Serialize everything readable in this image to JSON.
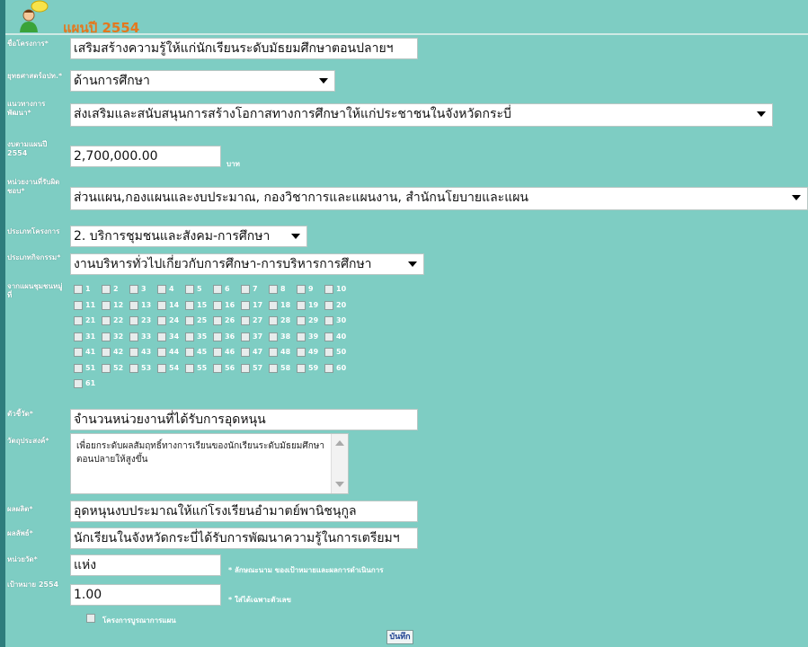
{
  "header": {
    "title": "แผนปี 2554"
  },
  "form": {
    "project_name": {
      "label": "ชื่อโครงการ*",
      "value": "เสริมสร้างความรู้ให้แก่นักเรียนระดับมัธยมศึกษาตอนปลายฯ"
    },
    "strategy": {
      "label": "ยุทธศาสตร์อปท.*",
      "value": "ด้านการศึกษา"
    },
    "development_guideline": {
      "label": "แนวทางการพัฒนา*",
      "value": "ส่งเสริมและสนับสนุนการสร้างโอกาสทางการศึกษาให้แก่ประชาชนในจังหวัดกระบี่"
    },
    "budget": {
      "label": "งบตามแผนปี 2554",
      "value": "2,700,000.00",
      "unit": "บาท"
    },
    "responsible_unit": {
      "label": "หน่วยงานที่รับผิดชอบ*",
      "value": "ส่วนแผน,กองแผนและงบประมาณ, กองวิชาการและแผนงาน, สำนักนโยบายและแผน"
    },
    "project_type": {
      "label": "ประเภทโครงการ",
      "value": "2. บริการชุมชนและสังคม-การศึกษา"
    },
    "activity_type": {
      "label": "ประเภทกิจกรรม*",
      "value": "งานบริหารทั่วไปเกี่ยวกับการศึกษา-การบริหารการศึกษา"
    },
    "village_plan": {
      "label": "จากแผนชุมชนหมู่ที่",
      "rows": [
        [
          "1",
          "2",
          "3",
          "4",
          "5",
          "6",
          "7",
          "8",
          "9",
          "10"
        ],
        [
          "11",
          "12",
          "13",
          "14",
          "15",
          "16",
          "17",
          "18",
          "19",
          "20"
        ],
        [
          "21",
          "22",
          "23",
          "24",
          "25",
          "26",
          "27",
          "28",
          "29",
          "30"
        ],
        [
          "31",
          "32",
          "33",
          "34",
          "35",
          "36",
          "37",
          "38",
          "39",
          "40"
        ],
        [
          "41",
          "42",
          "43",
          "44",
          "45",
          "46",
          "47",
          "48",
          "49",
          "50"
        ],
        [
          "51",
          "52",
          "53",
          "54",
          "55",
          "56",
          "57",
          "58",
          "59",
          "60"
        ],
        [
          "61"
        ]
      ]
    },
    "indicator": {
      "label": "ตัวชี้วัด*",
      "value": "จำนวนหน่วยงานที่ได้รับการอุดหนุน"
    },
    "objective": {
      "label": "วัตถุประสงค์*",
      "value": "เพื่อยกระดับผลสัมฤทธิ์ทางการเรียนของนักเรียนระดับมัธยมศึกษาตอนปลายให้สูงขึ้น"
    },
    "output": {
      "label": "ผลผลิต*",
      "value": "อุดหนุนงบประมาณให้แก่โรงเรียนอำมาตย์พานิชนุกูล"
    },
    "outcome": {
      "label": "ผลลัพธ์*",
      "value": "นักเรียนในจังหวัดกระบี่ได้รับการพัฒนาความรู้ในการเตรียมฯ"
    },
    "unit_count": {
      "label": "หน่วยวัด*",
      "value": "แห่ง",
      "note": "* ลักษณะนาม ของเป้าหมายและผลการดำเนินการ"
    },
    "target": {
      "label": "เป้าหมาย 2554",
      "value": "1.00",
      "note": "* ใส่ได้เฉพาะตัวเลข"
    },
    "integrated_project": {
      "label": "โครงการบูรณาการแผน"
    },
    "save_label": "บันทึก"
  }
}
